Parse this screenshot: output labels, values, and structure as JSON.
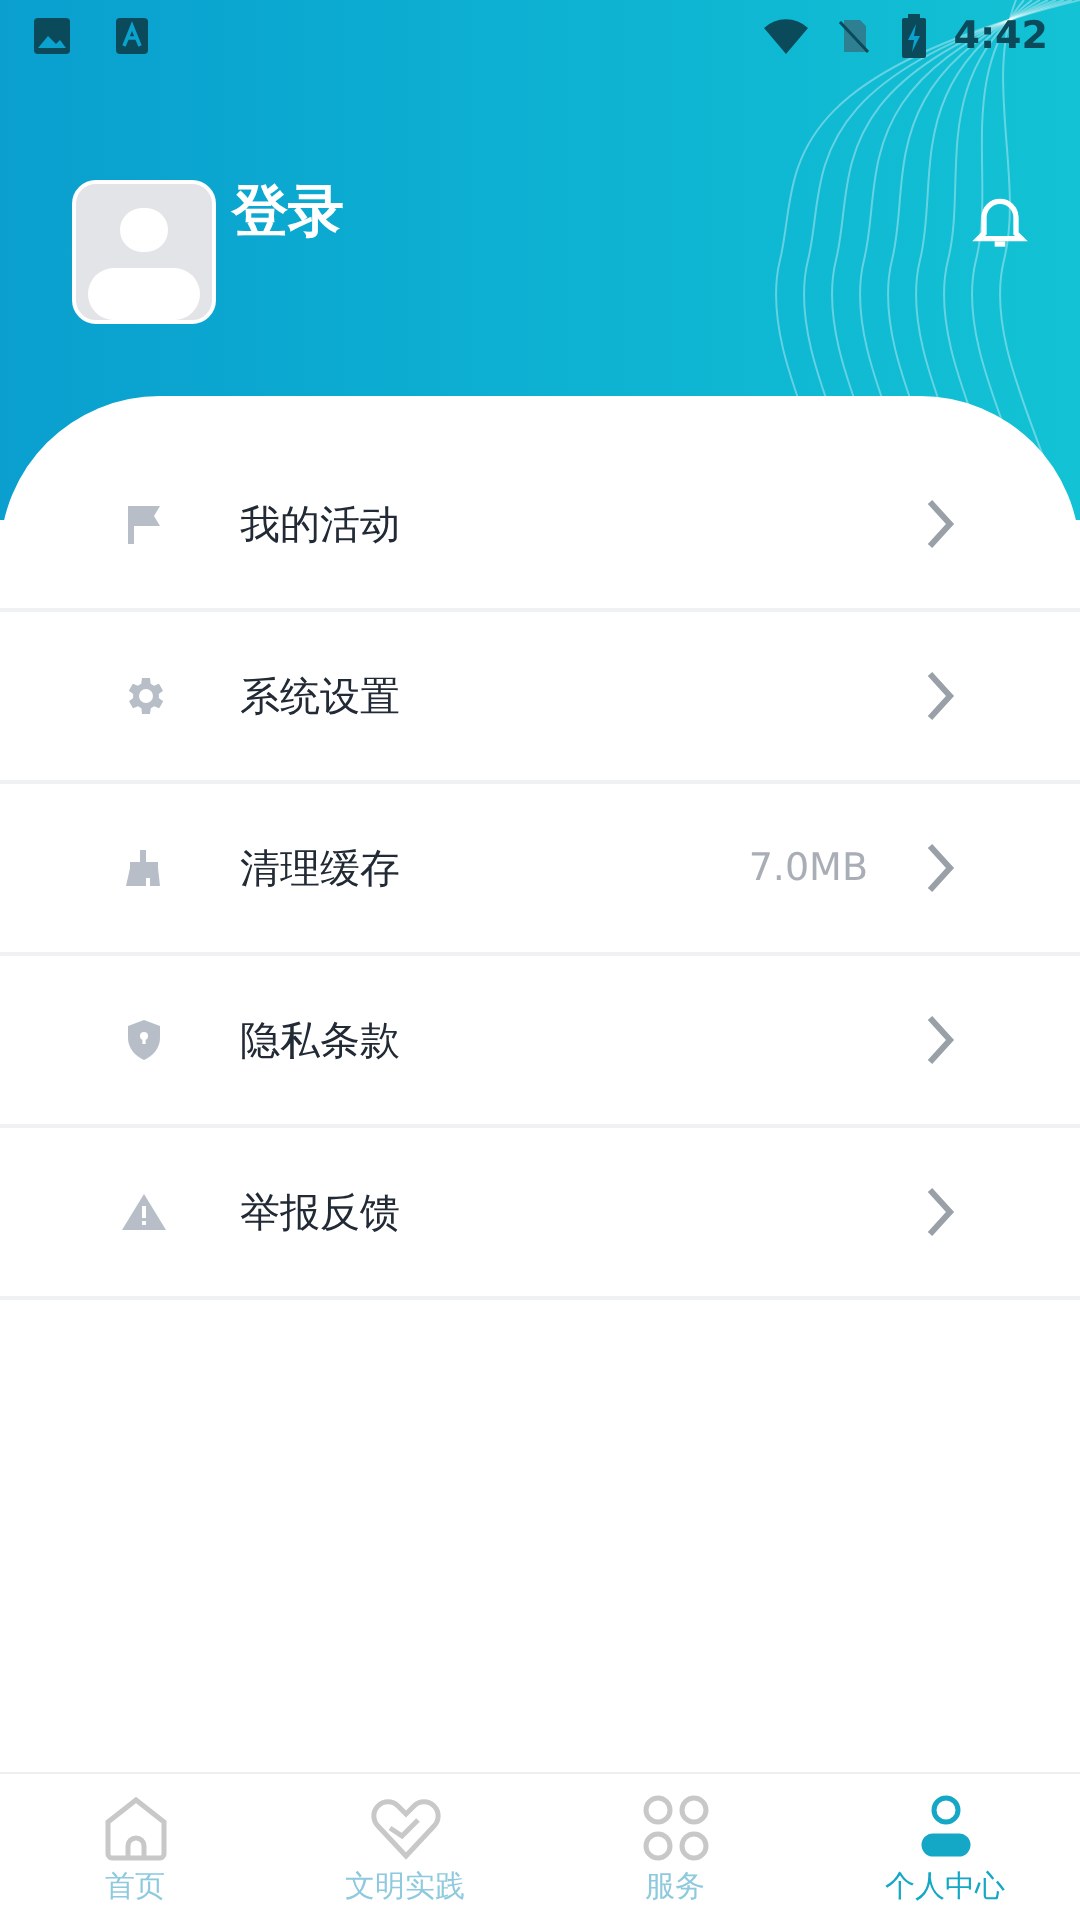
{
  "status_bar": {
    "time": "4:42"
  },
  "profile": {
    "name": "登录"
  },
  "menu": [
    {
      "kind": "flag",
      "label": "我的活动"
    },
    {
      "kind": "gear",
      "label": "系统设置"
    },
    {
      "kind": "brush",
      "label": "清理缓存",
      "value": "7.0MB"
    },
    {
      "kind": "shield",
      "label": "隐私条款"
    },
    {
      "kind": "warning",
      "label": "举报反馈"
    }
  ],
  "bottom_nav": [
    {
      "kind": "home",
      "label": "首页",
      "selected": false
    },
    {
      "kind": "heart",
      "label": "文明实践",
      "selected": false
    },
    {
      "kind": "grid",
      "label": "服务",
      "selected": false
    },
    {
      "kind": "person",
      "label": "个人中心",
      "selected": true
    }
  ]
}
